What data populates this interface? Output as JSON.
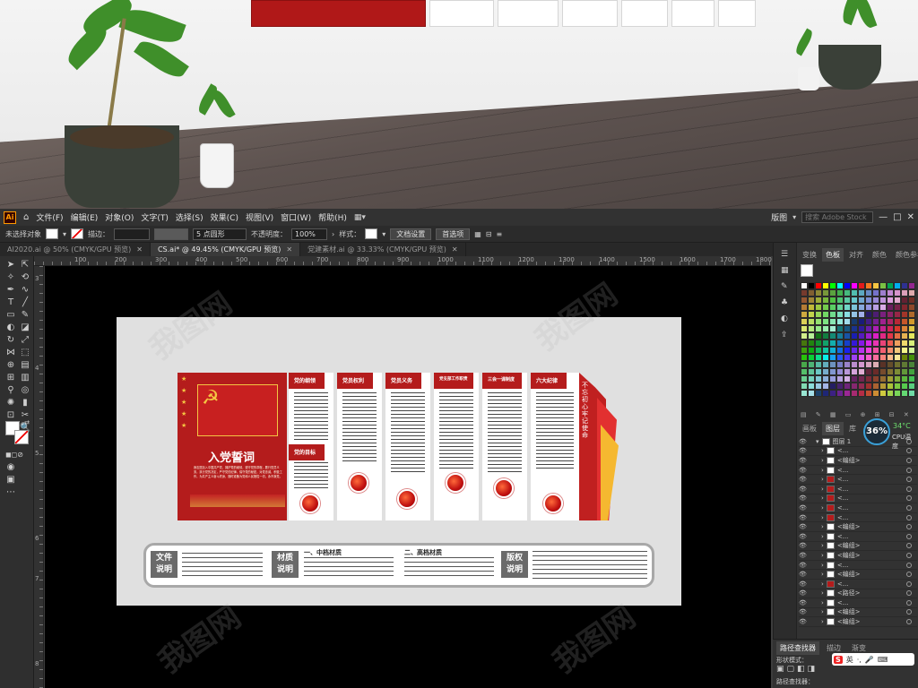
{
  "menubar": {
    "app_logo": "Ai",
    "items": [
      "文件(F)",
      "编辑(E)",
      "对象(O)",
      "文字(T)",
      "选择(S)",
      "效果(C)",
      "视图(V)",
      "窗口(W)",
      "帮助(H)"
    ],
    "workspace": "版图",
    "search_placeholder": "搜索 Adobe Stock"
  },
  "control_bar": {
    "selection_label": "未选择对象",
    "stroke_label": "描边：",
    "brush_label": "5 点圆形",
    "opacity_label": "不透明度：",
    "opacity_value": "100%",
    "style_label": "样式：",
    "doc_settings_button": "文档设置",
    "preferences_button": "首选项"
  },
  "tabs": [
    {
      "label": "AI2020.ai @ 50% (CMYK/GPU 预览)",
      "active": false
    },
    {
      "label": "CS.ai* @ 49.45% (CMYK/GPU 预览)",
      "active": true
    },
    {
      "label": "党建素材.ai @ 33.33% (CMYK/GPU 预览)",
      "active": false
    }
  ],
  "ruler": {
    "top_ticks": [
      "100",
      "200",
      "300",
      "400",
      "500",
      "600",
      "700",
      "800",
      "900",
      "1000",
      "1100",
      "1200",
      "1300",
      "1400",
      "1500",
      "1600",
      "1700",
      "1800"
    ],
    "left_ticks": [
      "3",
      "4",
      "5",
      "6",
      "7",
      "8"
    ]
  },
  "design": {
    "main_title": "入党誓词",
    "oath_text": "我志愿加入中国共产党，拥护党的纲领，遵守党的章程，履行党员义务，执行党的决定，严守党的纪律，保守党的秘密，对党忠诚，积极工作，为共产主义奋斗终身，随时准备为党和人民牺牲一切，永不叛党。",
    "vertical_slogan": "不忘初心 牢记使命",
    "panel_titles": [
      "党的纲领",
      "党员权利",
      "党员义务",
      "党支部工作职责",
      "三会一课制度",
      "六大纪律"
    ],
    "sub_title": "党的目标",
    "bottom": {
      "tag1": [
        "文件",
        "说明"
      ],
      "tag2": [
        "材质",
        "说明"
      ],
      "tag3": [
        "版权",
        "说明"
      ],
      "material_mid": "一、中档材质",
      "material_high": "二、高档材质"
    }
  },
  "right_dock": {
    "top_tabs": [
      {
        "label": "变换",
        "active": false
      },
      {
        "label": "色板",
        "active": true
      },
      {
        "label": "对齐",
        "active": false
      },
      {
        "label": "颜色",
        "active": false
      },
      {
        "label": "颜色参考",
        "active": false
      }
    ],
    "layers_tabs": [
      {
        "label": "画板",
        "active": false
      },
      {
        "label": "图层",
        "active": true
      },
      {
        "label": "库",
        "active": false
      }
    ],
    "layers": [
      {
        "name": "图层 1",
        "thumb": "white"
      },
      {
        "name": "<...",
        "thumb": "white"
      },
      {
        "name": "<编组>",
        "thumb": "white"
      },
      {
        "name": "<...",
        "thumb": "white"
      },
      {
        "name": "<...",
        "thumb": "red"
      },
      {
        "name": "<...",
        "thumb": "red"
      },
      {
        "name": "<...",
        "thumb": "red"
      },
      {
        "name": "<...",
        "thumb": "red"
      },
      {
        "name": "<...",
        "thumb": "red"
      },
      {
        "name": "<编组>",
        "thumb": "white"
      },
      {
        "name": "<...",
        "thumb": "white"
      },
      {
        "name": "<编组>",
        "thumb": "white"
      },
      {
        "name": "<编组>",
        "thumb": "white"
      },
      {
        "name": "<...",
        "thumb": "white"
      },
      {
        "name": "<编组>",
        "thumb": "white"
      },
      {
        "name": "<...",
        "thumb": "red"
      },
      {
        "name": "<路径>",
        "thumb": "white"
      },
      {
        "name": "<...",
        "thumb": "white"
      },
      {
        "name": "<编组>",
        "thumb": "white"
      },
      {
        "name": "<编组>",
        "thumb": "white"
      }
    ],
    "cpu_percent": "36%",
    "cpu_temp": "34°C",
    "cpu_label": "CPU温度",
    "bottom_tabs": [
      {
        "label": "路径查找器",
        "active": true
      },
      {
        "label": "描边",
        "active": false
      },
      {
        "label": "渐变",
        "active": false
      }
    ],
    "shape_mode_label": "形状模式：",
    "pathfinder_label": "路径查找器："
  },
  "watermark": "我图网",
  "colors": {
    "party_red": "#b41c1c",
    "gold": "#f4c542",
    "ui_dark": "#323232"
  }
}
